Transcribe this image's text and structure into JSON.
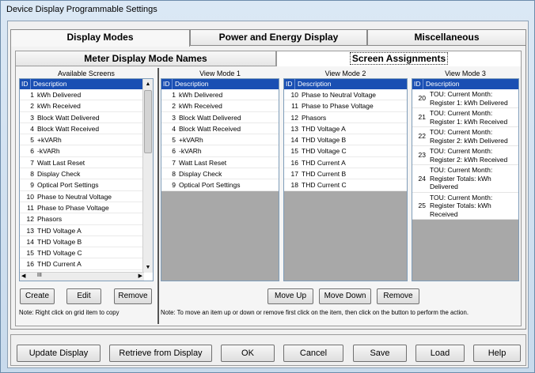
{
  "window": {
    "title": "Device Display Programmable Settings"
  },
  "tabs": [
    "Display Modes",
    "Power and Energy Display",
    "Miscellaneous"
  ],
  "subtabs": [
    "Meter Display Mode Names",
    "Screen Assignments"
  ],
  "available": {
    "header": "Available Screens",
    "col_id": "ID",
    "col_desc": "Description",
    "rows": [
      [
        "1",
        "kWh Delivered"
      ],
      [
        "2",
        "kWh Received"
      ],
      [
        "3",
        "Block Watt Delivered"
      ],
      [
        "4",
        "Block Watt Received"
      ],
      [
        "5",
        "+kVARh"
      ],
      [
        "6",
        "-kVARh"
      ],
      [
        "7",
        "Watt Last Reset"
      ],
      [
        "8",
        "Display Check"
      ],
      [
        "9",
        "Optical Port Settings"
      ],
      [
        "10",
        "Phase to Neutral Voltage"
      ],
      [
        "11",
        "Phase to Phase Voltage"
      ],
      [
        "12",
        "Phasors"
      ],
      [
        "13",
        "THD Voltage A"
      ],
      [
        "14",
        "THD Voltage B"
      ],
      [
        "15",
        "THD Voltage C"
      ],
      [
        "16",
        "THD Current A"
      ]
    ],
    "hscroll_label": "III"
  },
  "view1": {
    "header": "View Mode 1",
    "col_id": "ID",
    "col_desc": "Description",
    "rows": [
      [
        "1",
        "kWh Delivered"
      ],
      [
        "2",
        "kWh Received"
      ],
      [
        "3",
        "Block Watt Delivered"
      ],
      [
        "4",
        "Block Watt Received"
      ],
      [
        "5",
        "+kVARh"
      ],
      [
        "6",
        "-kVARh"
      ],
      [
        "7",
        "Watt Last Reset"
      ],
      [
        "8",
        "Display Check"
      ],
      [
        "9",
        "Optical Port Settings"
      ]
    ]
  },
  "view2": {
    "header": "View Mode 2",
    "col_id": "ID",
    "col_desc": "Description",
    "rows": [
      [
        "10",
        "Phase to Neutral Voltage"
      ],
      [
        "11",
        "Phase to Phase Voltage"
      ],
      [
        "12",
        "Phasors"
      ],
      [
        "13",
        "THD Voltage A"
      ],
      [
        "14",
        "THD Voltage B"
      ],
      [
        "15",
        "THD Voltage C"
      ],
      [
        "16",
        "THD Current A"
      ],
      [
        "17",
        "THD Current B"
      ],
      [
        "18",
        "THD Current C"
      ]
    ]
  },
  "view3": {
    "header": "View Mode 3",
    "col_id": "ID",
    "col_desc": "Description",
    "rows": [
      {
        "id": "20",
        "desc": "TOU: Current Month: Register 1: kWh Delivered"
      },
      {
        "id": "21",
        "desc": "TOU: Current Month: Register 1: kWh Received"
      },
      {
        "id": "22",
        "desc": "TOU: Current Month: Register 2: kWh Delivered"
      },
      {
        "id": "23",
        "desc": "TOU: Current Month: Register 2: kWh Received"
      },
      {
        "id": "24",
        "desc": "TOU: Current Month: Register Totals: kWh Delivered"
      },
      {
        "id": "25",
        "desc": "TOU: Current Month: Register Totals: kWh Received"
      }
    ]
  },
  "left_buttons": {
    "create": "Create",
    "edit": "Edit",
    "remove": "Remove"
  },
  "mid_buttons": {
    "move_up": "Move Up",
    "move_down": "Move Down",
    "remove": "Remove"
  },
  "notes": {
    "left": "Note: Right click on grid item to copy",
    "right": "Note: To move an item up or down or remove first click on the item, then click on the button to perform the action."
  },
  "bottom": {
    "update": "Update Display",
    "retrieve": "Retrieve from Display",
    "ok": "OK",
    "cancel": "Cancel",
    "save": "Save",
    "load": "Load",
    "help": "Help"
  }
}
